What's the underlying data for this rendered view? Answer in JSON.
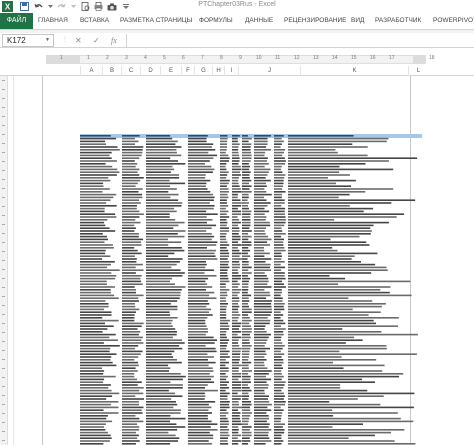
{
  "title_bar": {
    "title": "PTChapter03Rus - Excel",
    "icons": [
      "excel-logo-icon",
      "save-icon",
      "undo-icon",
      "redo-icon",
      "print-preview-icon",
      "quick-print-icon",
      "camera-icon"
    ]
  },
  "ribbon": {
    "file_tab": "ФАЙЛ",
    "tabs": [
      "ГЛАВНАЯ",
      "ВСТАВКА",
      "РАЗМЕТКА СТРАНИЦЫ",
      "ФОРМУЛЫ",
      "ДАННЫЕ",
      "РЕЦЕНЗИРОВАНИЕ",
      "ВИД",
      "РАЗРАБОТЧИК",
      "POWERPIVOT"
    ],
    "accent": "#217346"
  },
  "formula_bar": {
    "name_box": "K172",
    "cancel_symbol": "✕",
    "enter_symbol": "✓",
    "function_symbol": "fx",
    "formula": ""
  },
  "ruler": {
    "numbers": [
      "1",
      "1",
      "2",
      "3",
      "4",
      "5",
      "6",
      "7",
      "8",
      "9",
      "10",
      "11",
      "12",
      "13",
      "14",
      "15",
      "16",
      "17",
      "18"
    ]
  },
  "columns": [
    "A",
    "B",
    "C",
    "D",
    "E",
    "F",
    "G",
    "H",
    "I",
    "J",
    "K",
    "L"
  ],
  "report": {
    "rows": 111,
    "header_color": "#a6c8e8"
  }
}
